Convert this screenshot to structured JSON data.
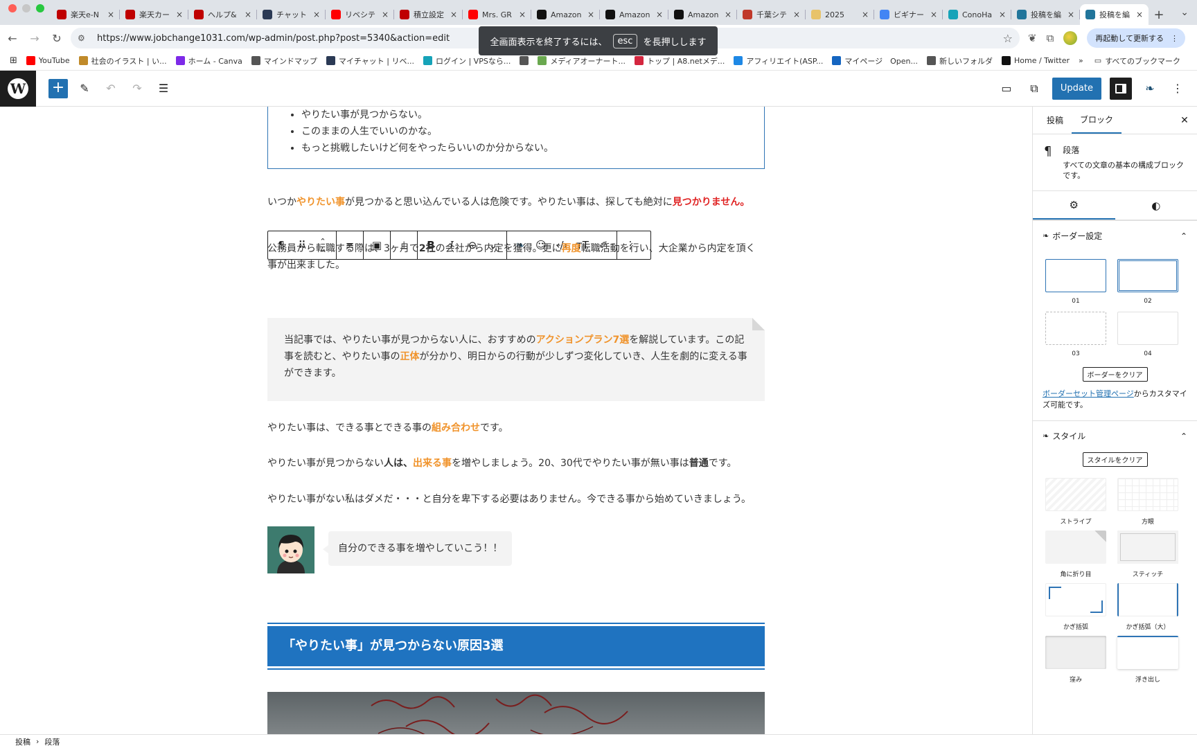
{
  "browser": {
    "tabs": [
      {
        "title": "楽天e-N",
        "icon": "rakuten-icon",
        "color": "#bf0000"
      },
      {
        "title": "楽天カー",
        "icon": "rakuten-icon",
        "color": "#bf0000"
      },
      {
        "title": "ヘルプ&",
        "icon": "rakuten-icon",
        "color": "#bf0000"
      },
      {
        "title": "チャット",
        "icon": "chat-star-icon",
        "color": "#2b3a55"
      },
      {
        "title": "リベシテ",
        "icon": "youtube-icon",
        "color": "#ff0000"
      },
      {
        "title": "積立設定",
        "icon": "rakuten-icon",
        "color": "#bf0000"
      },
      {
        "title": "Mrs. GR",
        "icon": "youtube-icon",
        "color": "#ff0000"
      },
      {
        "title": "Amazon",
        "icon": "amazon-icon",
        "color": "#111111"
      },
      {
        "title": "Amazon",
        "icon": "amazon-icon",
        "color": "#111111"
      },
      {
        "title": "Amazon",
        "icon": "amazon-icon",
        "color": "#111111"
      },
      {
        "title": "千葉シテ",
        "icon": "chiba-icon",
        "color": "#c0392b"
      },
      {
        "title": "2025",
        "icon": "calendar-icon",
        "color": "#e8c36a"
      },
      {
        "title": "ビギナー",
        "icon": "google-icon",
        "color": "#4285f4"
      },
      {
        "title": "ConoHa",
        "icon": "conoha-icon",
        "color": "#16a3b8"
      },
      {
        "title": "投稿を編",
        "icon": "wordpress-icon",
        "color": "#21759b"
      },
      {
        "title": "投稿を編",
        "icon": "wordpress-icon",
        "color": "#21759b",
        "active": true
      }
    ],
    "url": "https://www.jobchange1031.com/wp-admin/post.php?post=5340&action=edit",
    "relaunch_label": "再起動して更新する",
    "fullscreen_toast": {
      "before": "全画面表示を終了するには、",
      "key": "esc",
      "after": "を長押しします"
    },
    "bookmarks": [
      {
        "label": "YouTube",
        "icon": "youtube-icon",
        "color": "#ff0000"
      },
      {
        "label": "社会のイラスト | い...",
        "icon": "irasutoya-icon",
        "color": "#c08a2a"
      },
      {
        "label": "ホーム - Canva",
        "icon": "canva-icon",
        "color": "#7d2ae8"
      },
      {
        "label": "マインドマップ",
        "icon": "folder-icon",
        "color": "#555555"
      },
      {
        "label": "マイチャット | リベ...",
        "icon": "chat-star-icon",
        "color": "#2b3a55"
      },
      {
        "label": "ログイン | VPSなら...",
        "icon": "conoha-icon",
        "color": "#16a3b8"
      },
      {
        "label": "",
        "icon": "globe-icon",
        "color": "#555555"
      },
      {
        "label": "メディアオーナート...",
        "icon": "moshimo-icon",
        "color": "#6aa84f"
      },
      {
        "label": "トップ | A8.netメデ...",
        "icon": "a8-icon",
        "color": "#d4263f"
      },
      {
        "label": "アフィリエイト(ASP...",
        "icon": "asp-icon",
        "color": "#1e88e5"
      },
      {
        "label": "マイページ　Open...",
        "icon": "openrec-icon",
        "color": "#1565c0"
      },
      {
        "label": "新しいフォルダ",
        "icon": "folder-icon",
        "color": "#555555"
      },
      {
        "label": "Home / Twitter",
        "icon": "x-icon",
        "color": "#111111"
      }
    ],
    "all_bookmarks_label": "すべてのブックマーク"
  },
  "editor": {
    "update_label": "Update",
    "list_items": [
      "やりたい事が見つからない。",
      "このままの人生でいいのかな。",
      "もっと挑戦したいけど何をやったらいいのか分からない。"
    ],
    "p1": {
      "a": "いつか",
      "b": "やりたい事",
      "c": "が見つかると思い込んでいる人は危険です。やりたい事は、探しても絶対に",
      "d": "見つかりません。"
    },
    "p2": {
      "a": "公務員から転職する際は、3ヶ月で",
      "b": "2社",
      "c": "の会社から内定を獲得。更に",
      "d": "再度",
      "e": "転職活動を行い、大企業から内定を頂く事が出来ました。"
    },
    "memo": {
      "a": "当記事では、やりたい事が見つからない人に、おすすめの",
      "b": "アクションプラン7選",
      "c": "を解説しています。この記事を読むと、やりたい事の",
      "d": "正体",
      "e": "が分かり、明日からの行動が少しずつ変化していき、人生を劇的に変える事ができます。"
    },
    "p3": {
      "a": "やりたい事は、できる事とできる事の",
      "b": "組み合わせ",
      "c": "です。"
    },
    "p4": {
      "a": "やりたい事が見つからない",
      "b": "人は、",
      "c": "出来る事",
      "d": "を増やしましょう。20、30代でやりたい事が無い事は",
      "e": "普通",
      "f": "です。"
    },
    "p5": "やりたい事がない私はダメだ・・・と自分を卑下する必要はありません。今できる事から始めていきましょう。",
    "speech": "自分のできる事を増やしていこう！！",
    "heading": "「やりたい事」が見つからない原因3選"
  },
  "sidebar": {
    "tabs": [
      "投稿",
      "ブロック"
    ],
    "block_title": "段落",
    "block_desc": "すべての文章の基本の構成ブロックです。",
    "border_panel": "ボーダー設定",
    "border_presets": [
      "01",
      "02",
      "03",
      "04"
    ],
    "border_clear": "ボーダーをクリア",
    "note_link": "ボーダーセット管理ページ",
    "note_rest": "からカスタマイズ可能です。",
    "style_panel": "スタイル",
    "style_clear": "スタイルをクリア",
    "styles": [
      "ストライプ",
      "方眼",
      "角に折り目",
      "スティッチ",
      "かぎ括弧",
      "かぎ括弧（大）",
      "窪み",
      "浮き出し"
    ]
  },
  "footer": {
    "crumb1": "投稿",
    "crumb2": "段落"
  }
}
